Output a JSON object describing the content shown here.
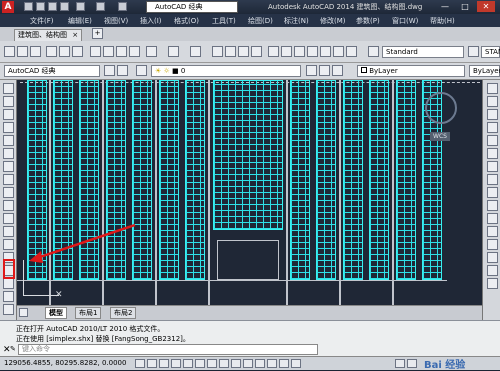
{
  "app": {
    "logo_letter": "A",
    "workspace": "AutoCAD 经典",
    "title": "Autodesk AutoCAD 2014   建筑图、结构图.dwg",
    "window_buttons": [
      "—",
      "□",
      "✕"
    ]
  },
  "menu": [
    "文件(F)",
    "编辑(E)",
    "视图(V)",
    "插入(I)",
    "格式(O)",
    "工具(T)",
    "绘图(D)",
    "标注(N)",
    "修改(M)",
    "参数(P)",
    "窗口(W)",
    "帮助(H)"
  ],
  "file_tab": "建筑图、结构图",
  "toolbar": {
    "text_style": "Standard",
    "dim_style_prefix": "STAN",
    "workspace2": "AutoCAD 经典",
    "layer_value": "0",
    "color_value": "ByLayer",
    "linetype_value": "ByLayer"
  },
  "viewcube_label": "WCS",
  "layouts": [
    "模型",
    "布局1",
    "布局2"
  ],
  "command": {
    "lines": [
      "正在打开 AutoCAD 2010/LT 2010 格式文件。",
      "正在使用 [simplex.shx] 替换 [FangSong_GB2312]。"
    ],
    "placeholder": "键入命令"
  },
  "status": {
    "coords": "129056.4855, 80295.8282, 0.0000"
  },
  "watermark": "Bai 经验",
  "icons": [
    "close-icon",
    "wrench-icon",
    "search-icon"
  ],
  "colors": {
    "drawing": "#2ee0e8",
    "highlight": "#e01818",
    "canvas": "#1f2736"
  }
}
